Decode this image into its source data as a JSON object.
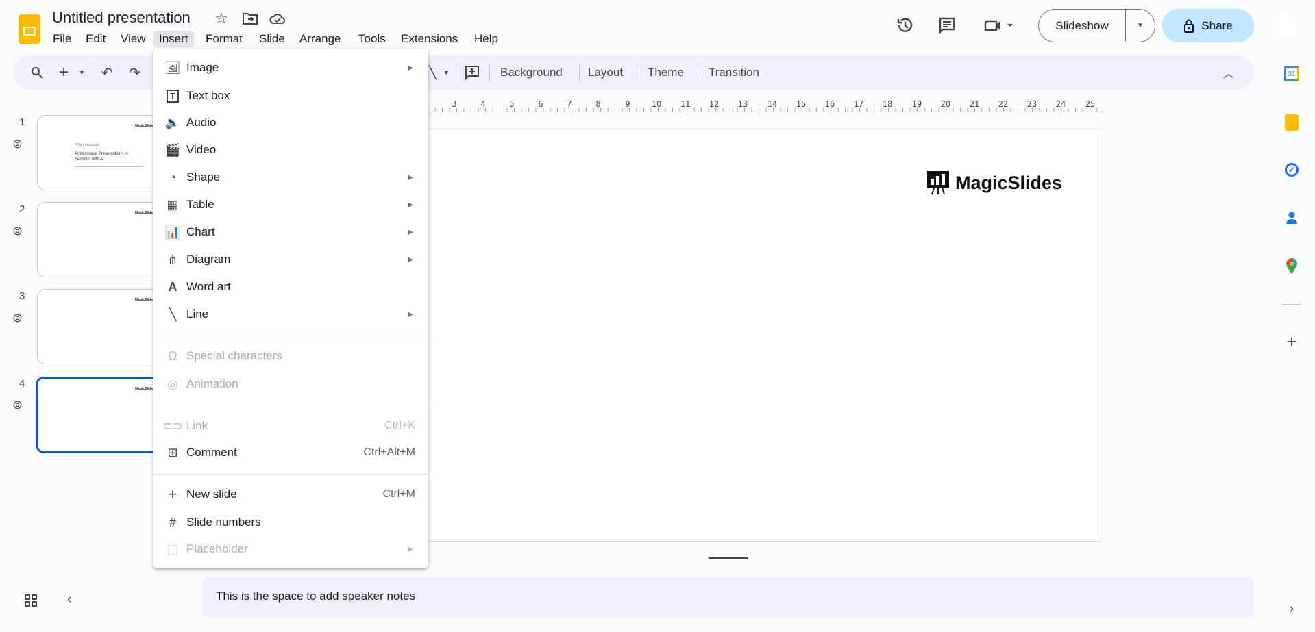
{
  "app": {
    "title": "Untitled presentation"
  },
  "menubar": [
    "File",
    "Edit",
    "View",
    "Insert",
    "Format",
    "Slide",
    "Arrange",
    "Tools",
    "Extensions",
    "Help"
  ],
  "header": {
    "slideshow": "Slideshow",
    "share": "Share"
  },
  "toolbar": {
    "background": "Background",
    "layout": "Layout",
    "theme": "Theme",
    "transition": "Transition"
  },
  "ruler": [
    "3",
    "4",
    "5",
    "6",
    "7",
    "8",
    "9",
    "10",
    "11",
    "12",
    "13",
    "14",
    "15",
    "16",
    "17",
    "18",
    "19",
    "20",
    "21",
    "22",
    "23",
    "24",
    "25"
  ],
  "filmstrip": {
    "slides": [
      "1",
      "2",
      "3",
      "4"
    ],
    "selected": "4",
    "thumb1": {
      "kicker": "PPts in seconds",
      "title": "Professional Presentations in Seconds with AI",
      "logo": "MagicSlides"
    }
  },
  "slide": {
    "logo": "MagicSlides"
  },
  "notes": {
    "text": "This is the space to add speaker notes"
  },
  "insert_menu": {
    "items": [
      {
        "label": "Image",
        "submenu": true
      },
      {
        "label": "Text box"
      },
      {
        "label": "Audio"
      },
      {
        "label": "Video"
      },
      {
        "label": "Shape",
        "submenu": true
      },
      {
        "label": "Table",
        "submenu": true
      },
      {
        "label": "Chart",
        "submenu": true
      },
      {
        "label": "Diagram",
        "submenu": true
      },
      {
        "label": "Word art"
      },
      {
        "label": "Line",
        "submenu": true
      },
      {
        "label": "Special characters",
        "disabled": true
      },
      {
        "label": "Animation",
        "disabled": true
      },
      {
        "label": "Link",
        "shortcut": "Ctrl+K",
        "disabled": true
      },
      {
        "label": "Comment",
        "shortcut": "Ctrl+Alt+M"
      },
      {
        "label": "New slide",
        "shortcut": "Ctrl+M"
      },
      {
        "label": "Slide numbers"
      },
      {
        "label": "Placeholder",
        "submenu": true,
        "disabled": true
      }
    ]
  },
  "sidebar_right": {
    "calendar_day": "31"
  },
  "colors": {
    "accent": "#0b57d0",
    "share_bg": "#c2e7ff",
    "toolbar_bg": "#edf2fa",
    "logo": "#fbbc04"
  }
}
